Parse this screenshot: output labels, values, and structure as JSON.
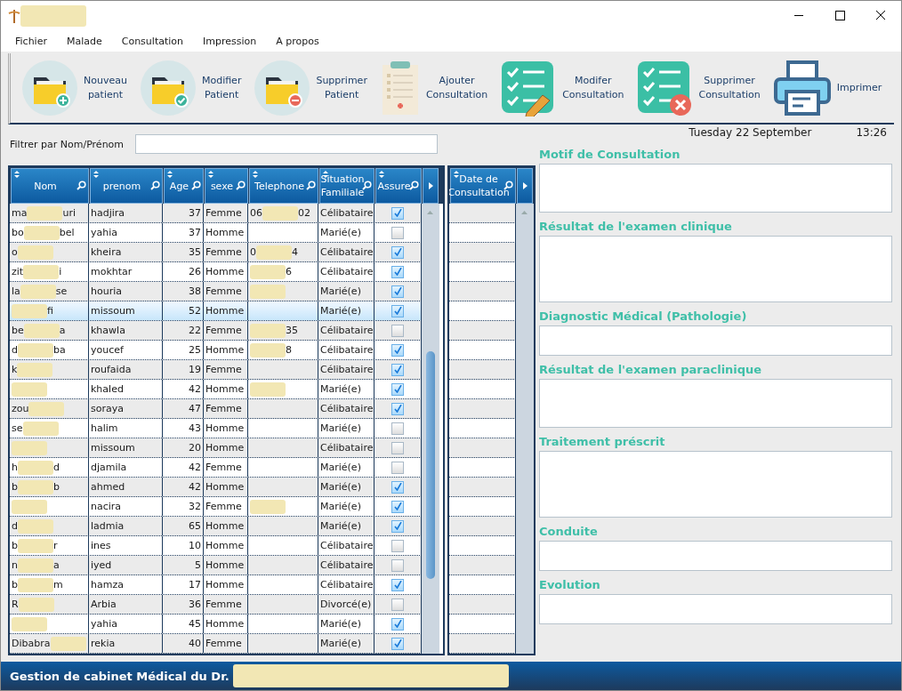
{
  "menu": [
    {
      "label": "Fichier"
    },
    {
      "label": "Malade"
    },
    {
      "label": "Consultation"
    },
    {
      "label": "Impression"
    },
    {
      "label": "A propos"
    }
  ],
  "toolbar": [
    {
      "kind": "folder-add",
      "lines": [
        "Nouveau",
        "patient"
      ]
    },
    {
      "kind": "folder-check",
      "lines": [
        "Modifier",
        "Patient"
      ]
    },
    {
      "kind": "folder-remove",
      "lines": [
        "Supprimer",
        "Patient"
      ]
    },
    {
      "kind": "clipboard",
      "lines": [
        "Ajouter",
        "Consultation"
      ]
    },
    {
      "kind": "checklist-edit",
      "lines": [
        "Modifer",
        "Consultation"
      ]
    },
    {
      "kind": "checklist-delete",
      "lines": [
        "Supprimer",
        "Consultation"
      ]
    },
    {
      "kind": "printer",
      "lines": [
        "Imprimer"
      ]
    }
  ],
  "filter": {
    "label": "Filtrer par Nom/Prénom"
  },
  "date": "Tuesday 22 September",
  "time": "13:26",
  "table": {
    "columns": [
      {
        "lines": [
          "Nom"
        ]
      },
      {
        "lines": [
          "prenom"
        ]
      },
      {
        "lines": [
          "Age"
        ]
      },
      {
        "lines": [
          "sexe"
        ]
      },
      {
        "lines": [
          "Telephone"
        ]
      },
      {
        "lines": [
          "Situation",
          "Familiale"
        ]
      },
      {
        "lines": [
          "Assure"
        ]
      }
    ],
    "rows": [
      {
        "nom": {
          "start": "ma",
          "end": "uri"
        },
        "prenom": "hadjira",
        "age": "37",
        "sexe": "Femme",
        "telephone": {
          "start": "06",
          "end": "02"
        },
        "situation": "Célibataire",
        "assure": true,
        "selected": false
      },
      {
        "nom": {
          "start": "bo",
          "end": "bel"
        },
        "prenom": "yahia",
        "age": "37",
        "sexe": "Homme",
        "situation": "Marié(e)",
        "assure": false,
        "selected": false
      },
      {
        "nom": {
          "start": "o"
        },
        "prenom": "kheira",
        "age": "35",
        "sexe": "Femme",
        "telephone": {
          "start": "0",
          "end": "4"
        },
        "situation": "Célibataire",
        "assure": true,
        "selected": false
      },
      {
        "nom": {
          "start": "zit",
          "end": "i"
        },
        "prenom": "mokhtar",
        "age": "26",
        "sexe": "Homme",
        "telephone": {
          "end": "6"
        },
        "situation": "Célibataire",
        "assure": true,
        "selected": false
      },
      {
        "nom": {
          "start": "la",
          "end": "se"
        },
        "prenom": "houria",
        "age": "38",
        "sexe": "Femme",
        "telephone": {},
        "situation": "Marié(e)",
        "assure": true,
        "selected": false
      },
      {
        "nom": {
          "end": "fi"
        },
        "prenom": "missoum",
        "age": "52",
        "sexe": "Homme",
        "situation": "Marié(e)",
        "assure": true,
        "selected": true
      },
      {
        "nom": {
          "start": "be",
          "end": "a"
        },
        "prenom": "khawla",
        "age": "22",
        "sexe": "Femme",
        "telephone": {
          "end": "35"
        },
        "situation": "Célibataire",
        "assure": false,
        "selected": false
      },
      {
        "nom": {
          "start": "d",
          "end": "ba"
        },
        "prenom": "youcef",
        "age": "25",
        "sexe": "Homme",
        "telephone": {
          "end": "8"
        },
        "situation": "Célibataire",
        "assure": true,
        "selected": false
      },
      {
        "nom": {
          "start": "k"
        },
        "prenom": "roufaida",
        "age": "19",
        "sexe": "Femme",
        "situation": "Célibataire",
        "assure": true,
        "selected": false
      },
      {
        "nom": {},
        "prenom": "khaled",
        "age": "42",
        "sexe": "Homme",
        "telephone": {},
        "situation": "Marié(e)",
        "assure": true,
        "selected": false
      },
      {
        "nom": {
          "start": "zou"
        },
        "prenom": "soraya",
        "age": "47",
        "sexe": "Femme",
        "situation": "Célibataire",
        "assure": true,
        "selected": false
      },
      {
        "nom": {
          "start": "se"
        },
        "prenom": "halim",
        "age": "43",
        "sexe": "Homme",
        "situation": "Marié(e)",
        "assure": false,
        "selected": false
      },
      {
        "nom": {},
        "prenom": "missoum",
        "age": "20",
        "sexe": "Homme",
        "situation": "Célibataire",
        "assure": false,
        "selected": false
      },
      {
        "nom": {
          "start": "h",
          "end": "d"
        },
        "prenom": "djamila",
        "age": "42",
        "sexe": "Femme",
        "situation": "Marié(e)",
        "assure": false,
        "selected": false
      },
      {
        "nom": {
          "start": "b",
          "end": "b"
        },
        "prenom": "ahmed",
        "age": "42",
        "sexe": "Homme",
        "situation": "Marié(e)",
        "assure": true,
        "selected": false
      },
      {
        "nom": {},
        "prenom": "nacira",
        "age": "32",
        "sexe": "Femme",
        "telephone": {},
        "situation": "Marié(e)",
        "assure": true,
        "selected": false
      },
      {
        "nom": {
          "start": "d"
        },
        "prenom": "ladmia",
        "age": "65",
        "sexe": "Homme",
        "situation": "Marié(e)",
        "assure": true,
        "selected": false
      },
      {
        "nom": {
          "start": "b",
          "end": "r"
        },
        "prenom": "ines",
        "age": "10",
        "sexe": "Homme",
        "situation": "Célibataire",
        "assure": false,
        "selected": false
      },
      {
        "nom": {
          "start": "n",
          "end": "a"
        },
        "prenom": "iyed",
        "age": "5",
        "sexe": "Homme",
        "situation": "Célibataire",
        "assure": false,
        "selected": false
      },
      {
        "nom": {
          "start": "b",
          "end": "m"
        },
        "prenom": "hamza",
        "age": "17",
        "sexe": "Homme",
        "situation": "Célibataire",
        "assure": true,
        "selected": false
      },
      {
        "nom": {
          "start": "R"
        },
        "prenom": "Arbia",
        "age": "36",
        "sexe": "Femme",
        "situation": "Divorcé(e)",
        "assure": false,
        "selected": false
      },
      {
        "nom": {},
        "prenom": "yahia",
        "age": "45",
        "sexe": "Homme",
        "situation": "Marié(e)",
        "assure": true,
        "selected": false
      },
      {
        "nom": {
          "start": "Dibabra"
        },
        "prenom": "rekia",
        "age": "40",
        "sexe": "Femme",
        "situation": "Marié(e)",
        "assure": true,
        "selected": false
      }
    ]
  },
  "consultations": {
    "columns": [
      {
        "lines": [
          "Date de",
          "Consultation"
        ]
      }
    ]
  },
  "form": [
    {
      "label": "Motif de Consultation"
    },
    {
      "label": "Résultat de l'examen clinique"
    },
    {
      "label": "Diagnostic Médical (Pathologie)"
    },
    {
      "label": "Résultat de l'examen paraclinique"
    },
    {
      "label": "Traitement préscrit"
    },
    {
      "label": "Conduite"
    },
    {
      "label": "Evolution"
    }
  ],
  "status_bar": {
    "text": "Gestion de cabinet Médical du Dr."
  }
}
